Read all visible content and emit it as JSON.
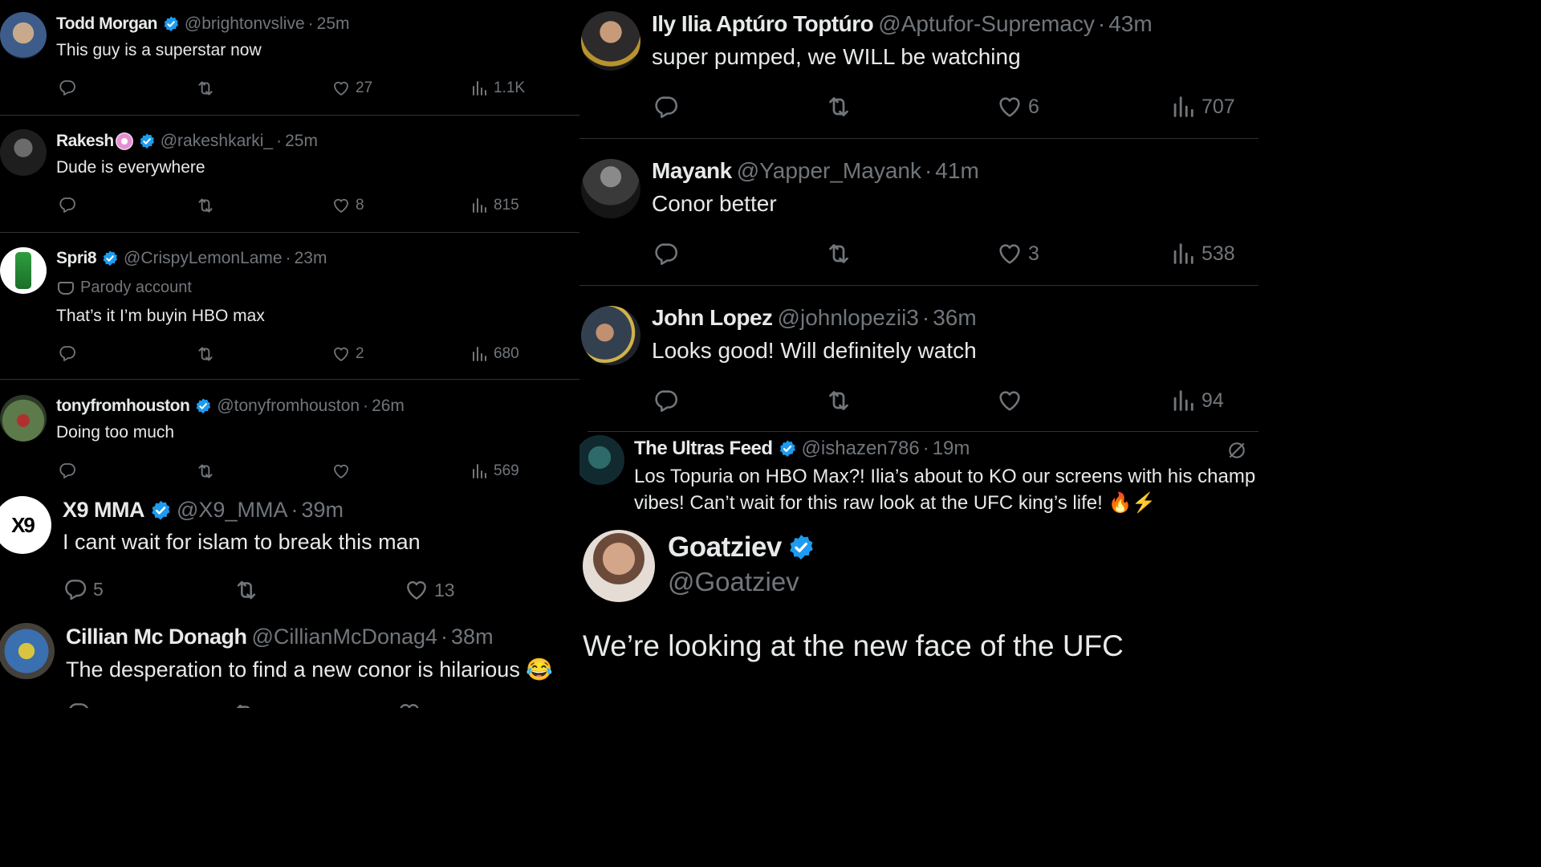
{
  "colors": {
    "background": "#000000",
    "text": "#e7e9ea",
    "muted": "#71767b",
    "verified": "#1d9bf0",
    "divider": "#2f3336"
  },
  "left": {
    "tweets": [
      {
        "name": "Todd Morgan",
        "handle": "@brightonvslive",
        "time": "25m",
        "text": "This guy is a superstar now",
        "verified": true,
        "likes": "27",
        "views": "1.1K"
      },
      {
        "name": "Rakesh",
        "handle": "@rakeshkarki_",
        "time": "25m",
        "text": "Dude is everywhere",
        "verified": true,
        "likes": "8",
        "views": "815"
      },
      {
        "name": "Spri8",
        "handle": "@CrispyLemonLame",
        "time": "23m",
        "label": "Parody account",
        "text": "That’s it I’m buyin HBO max",
        "verified": true,
        "likes": "2",
        "views": "680"
      },
      {
        "name": "tonyfromhouston",
        "handle": "@tonyfromhouston",
        "time": "26m",
        "text": "Doing too much",
        "verified": true,
        "likes": "",
        "views": "569"
      },
      {
        "name": "X9 MMA",
        "handle": "@X9_MMA",
        "time": "39m",
        "text": "I cant wait for islam to break this man",
        "verified": true,
        "replies": "5",
        "likes": "13"
      },
      {
        "name": "Cillian Mc Donagh",
        "handle": "@CillianMcDonag4",
        "time": "38m",
        "text": "The desperation to find a new conor is hilarious 😂",
        "verified": false
      }
    ]
  },
  "right": {
    "tweets": [
      {
        "name": "Ily Ilia Aptúro Toptúro",
        "handle": "@Aptufor-Supremacy",
        "time": "43m",
        "text": "super pumped, we WILL be watching",
        "likes": "6",
        "views": "707"
      },
      {
        "name": "Mayank",
        "handle": "@Yapper_Mayank",
        "time": "41m",
        "text": "Conor better",
        "likes": "3",
        "views": "538"
      },
      {
        "name": "John Lopez",
        "handle": "@johnlopezii3",
        "time": "36m",
        "text": "Looks good! Will definitely watch",
        "likes": "",
        "views": "94"
      },
      {
        "name": "The Ultras Feed",
        "handle": "@ishazen786",
        "time": "19m",
        "verified": true,
        "text_line1": "Los Topuria on HBO Max?! Ilia’s about to KO our screens with his champ",
        "text_line2": "vibes!  Can’t wait for this raw look at the UFC king’s life! 🔥⚡"
      }
    ],
    "quoted": {
      "name": "Goatziev",
      "handle": "@Goatziev",
      "verified": true,
      "text": "We’re looking at the new face of the UFC"
    }
  },
  "icons": {
    "reply": "reply-icon",
    "retweet": "retweet-icon",
    "like": "heart-icon",
    "views": "views-icon",
    "verified": "verified-badge-icon",
    "parody": "parody-mask-icon",
    "grok": "slash-circle-icon"
  }
}
